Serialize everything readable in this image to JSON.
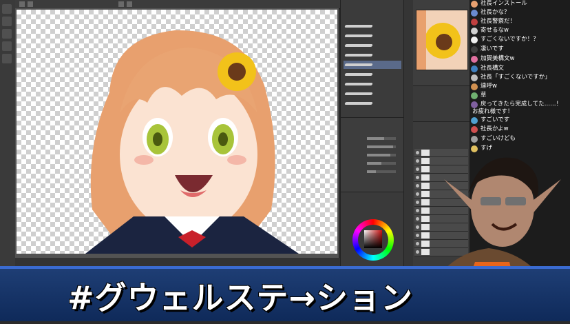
{
  "chat": {
    "messages": [
      {
        "text": "社長インストール",
        "avatar_color": "#e8a070"
      },
      {
        "text": "社長かな？",
        "avatar_color": "#6a8ad0"
      },
      {
        "text": "社長警察だ！",
        "avatar_color": "#c04040"
      },
      {
        "text": "寄せるなw",
        "avatar_color": "#d0d0d0"
      },
      {
        "text": "すごくないですか！？",
        "avatar_color": "#f0f0f0"
      },
      {
        "text": "凄いです",
        "avatar_color": "#404040"
      },
      {
        "text": "加賀美構文w",
        "avatar_color": "#e070a0"
      },
      {
        "text": "社長構文",
        "avatar_color": "#4080c0"
      },
      {
        "text": "社長「すごくないですか」",
        "avatar_color": "#c0c0c0"
      },
      {
        "text": "連呼w",
        "avatar_color": "#d09050"
      },
      {
        "text": "草",
        "avatar_color": "#70b070"
      },
      {
        "text": "戻ってきたら完成してた……！",
        "avatar_color": "#8060a0"
      },
      {
        "text": "お疲れ様です！",
        "avatar_color": "#8060a0"
      },
      {
        "text": "すごいです",
        "avatar_color": "#50a0d0"
      },
      {
        "text": "社長かよw",
        "avatar_color": "#d05050"
      },
      {
        "text": "すごいけども",
        "avatar_color": "#a0a0a0"
      },
      {
        "text": "すげ",
        "avatar_color": "#e0c060"
      }
    ]
  },
  "banner": {
    "title": "#グウェルステ→ション"
  },
  "colors": {
    "banner_bg": "#1f3f76",
    "accent": "#3a6bd1"
  }
}
